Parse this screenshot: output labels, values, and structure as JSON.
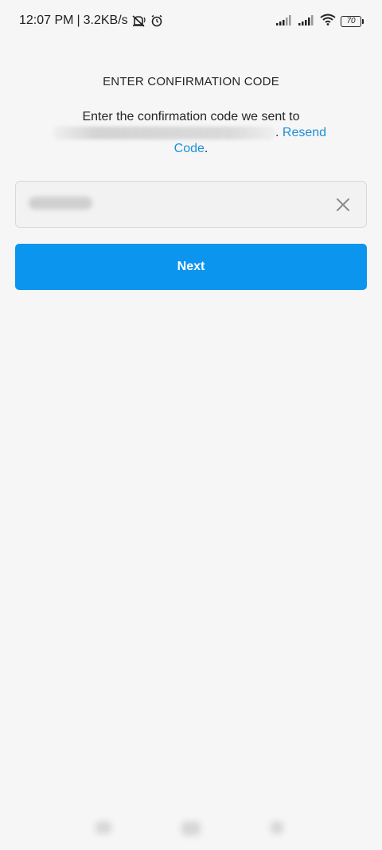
{
  "status_bar": {
    "time": "12:07 PM",
    "separator": "|",
    "network_speed": "3.2KB/s",
    "battery_level": "70",
    "icons": [
      "muted-icon",
      "alarm-icon",
      "signal-icon",
      "signal-icon",
      "wifi-icon",
      "battery-icon"
    ]
  },
  "screen": {
    "title": "ENTER CONFIRMATION CODE",
    "instruction_prefix": "Enter the confirmation code we sent to",
    "instruction_period": ". ",
    "resend_first": "Resend",
    "resend_second": "Code",
    "resend_period": "."
  },
  "code_input": {
    "value_redacted": true,
    "clear_icon": "close-icon"
  },
  "next_button": {
    "label": "Next",
    "color": "#0c95ef"
  },
  "colors": {
    "link": "#1b8fd6",
    "background": "#f6f6f6",
    "text": "#262626"
  }
}
